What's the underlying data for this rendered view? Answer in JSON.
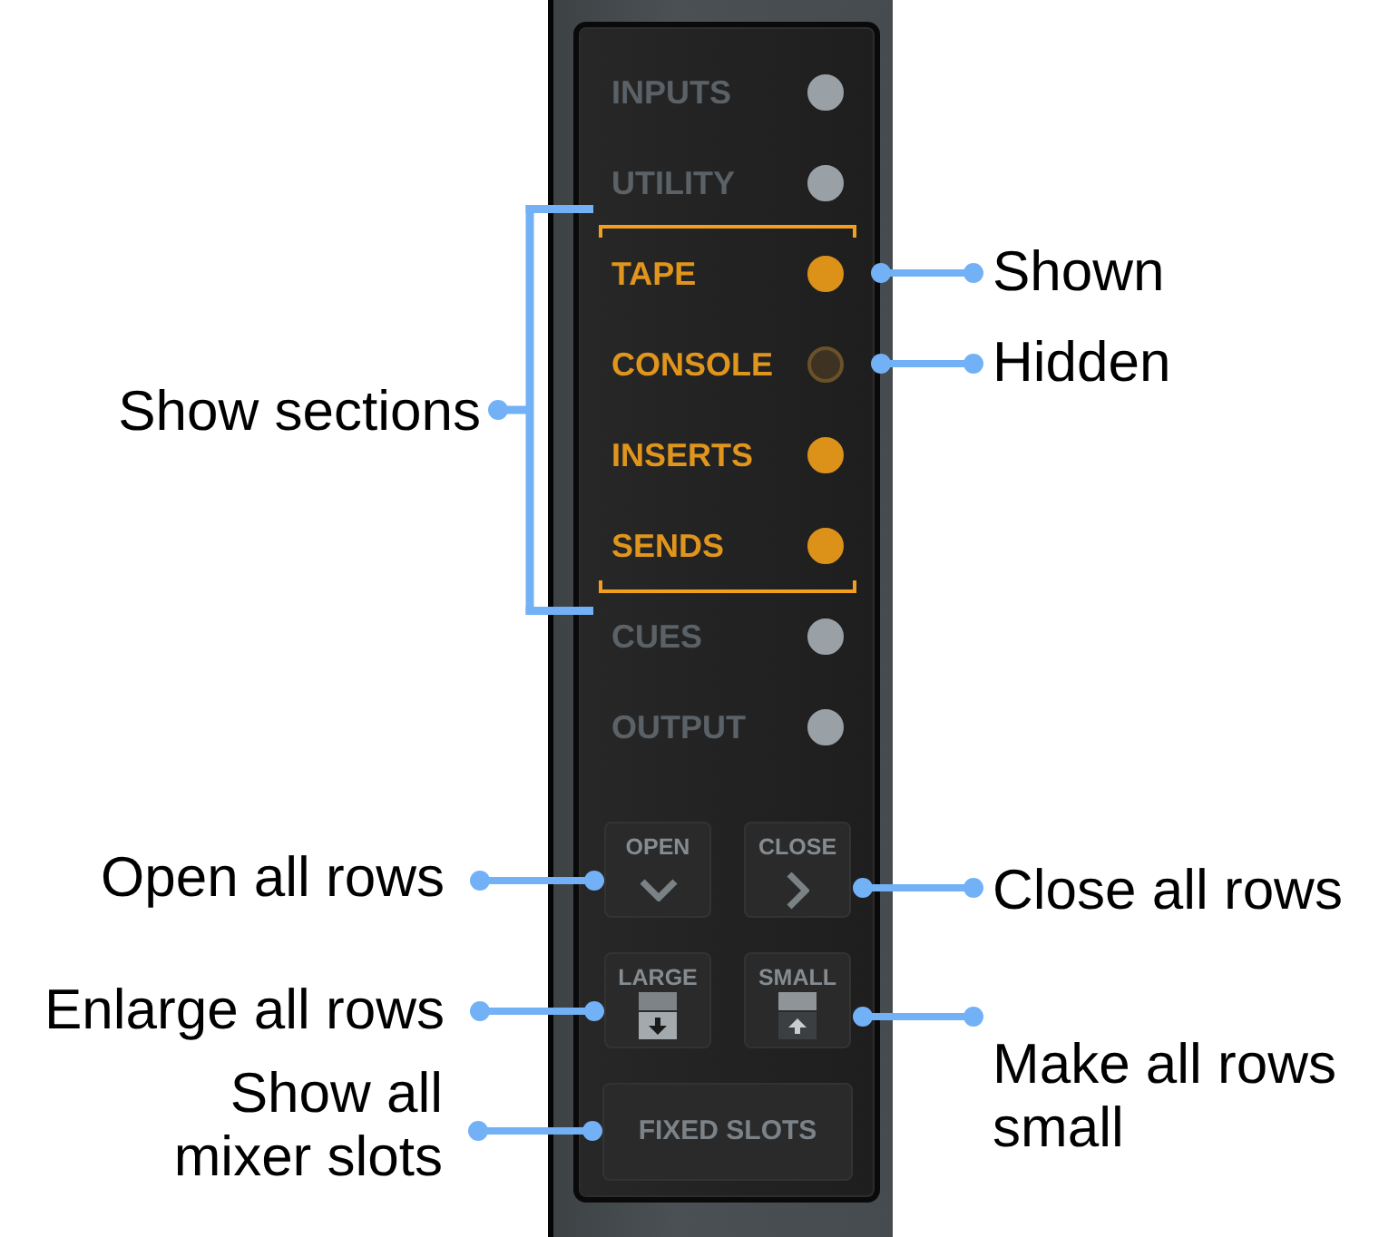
{
  "panel": {
    "sections": [
      {
        "label": "INPUTS",
        "highlighted": false,
        "shown": true
      },
      {
        "label": "UTILITY",
        "highlighted": false,
        "shown": true
      },
      {
        "label": "TAPE",
        "highlighted": true,
        "shown": true,
        "callout": "Shown"
      },
      {
        "label": "CONSOLE",
        "highlighted": true,
        "shown": false,
        "callout": "Hidden"
      },
      {
        "label": "INSERTS",
        "highlighted": true,
        "shown": true
      },
      {
        "label": "SENDS",
        "highlighted": true,
        "shown": true
      },
      {
        "label": "CUES",
        "highlighted": false,
        "shown": true
      },
      {
        "label": "OUTPUT",
        "highlighted": false,
        "shown": true
      }
    ],
    "sections_callout": "Show sections",
    "button_rows": [
      {
        "buttons": [
          {
            "label": "OPEN",
            "kind": "open",
            "callout": "Open all rows"
          },
          {
            "label": "CLOSE",
            "kind": "close",
            "callout": "Close all rows"
          }
        ]
      },
      {
        "buttons": [
          {
            "label": "LARGE",
            "kind": "enlarge",
            "callout": "Enlarge all rows"
          },
          {
            "label": "SMALL",
            "kind": "shrink",
            "callout": "Make all rows\nsmall"
          }
        ]
      }
    ],
    "fixed_slots_button": {
      "label": "FIXED SLOTS",
      "callout": "Show all\nmixer slots"
    }
  }
}
